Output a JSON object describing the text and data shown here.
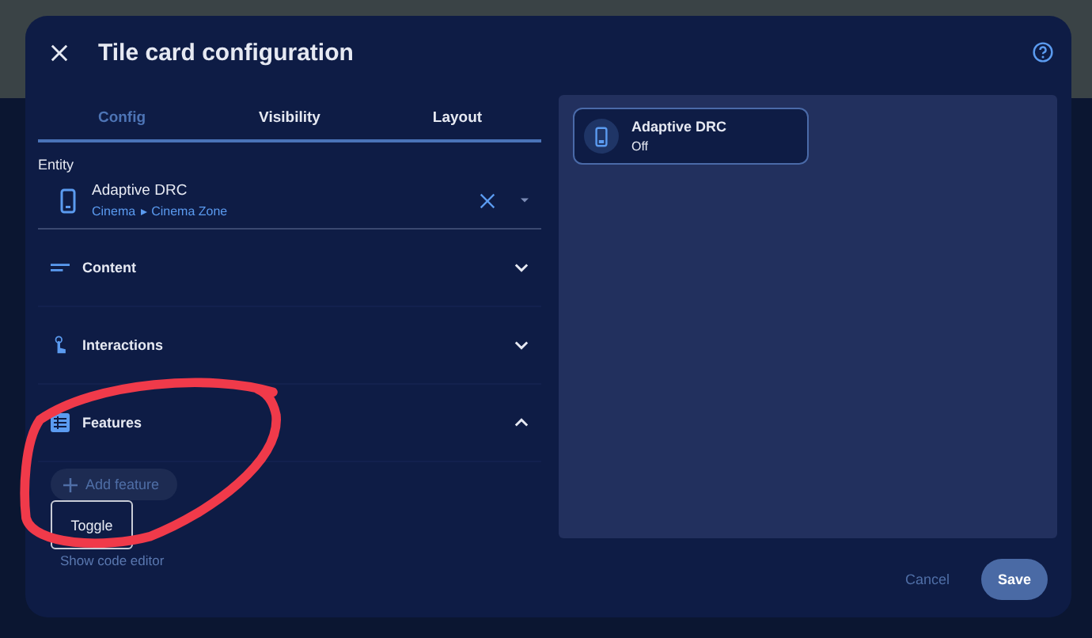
{
  "dialog": {
    "title": "Tile card configuration"
  },
  "tabs": [
    {
      "label": "Config",
      "selected": true
    },
    {
      "label": "Visibility",
      "selected": false
    },
    {
      "label": "Layout",
      "selected": false
    }
  ],
  "entity": {
    "label": "Entity",
    "name": "Adaptive DRC",
    "area": "Cinema",
    "zone": "Cinema Zone"
  },
  "sections": [
    {
      "kind": "content",
      "label": "Content",
      "expanded": false
    },
    {
      "kind": "interactions",
      "label": "Interactions",
      "expanded": false
    },
    {
      "kind": "features",
      "label": "Features",
      "expanded": true
    }
  ],
  "add_feature": {
    "label": "Add feature",
    "disabled": true
  },
  "tooltip": "Toggle",
  "code_editor_link": "Show code editor",
  "preview": {
    "name": "Adaptive DRC",
    "state": "Off"
  },
  "buttons": [
    {
      "kind": "text",
      "label": "Cancel"
    },
    {
      "kind": "filled",
      "label": "Save"
    }
  ]
}
